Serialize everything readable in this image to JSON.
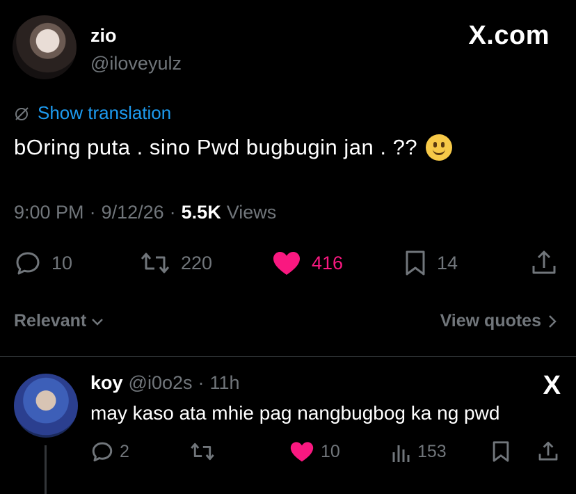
{
  "post": {
    "display_name": "zio",
    "handle": "@iloveyulz",
    "brand": "X.com",
    "show_translation": "Show translation",
    "text": "bOring  puta  .  sino Pwd  bugbugin  jan . ??",
    "emoji": "slightly-smiling-face",
    "time": "9:00 PM",
    "date": "9/12/26",
    "views_count": "5.5K",
    "views_label": "Views",
    "stats": {
      "replies": "10",
      "reposts": "220",
      "likes": "416",
      "bookmarks": "14"
    }
  },
  "sort": {
    "relevant_label": "Relevant",
    "view_quotes_label": "View quotes"
  },
  "reply": {
    "display_name": "koy",
    "handle": "@i0o2s",
    "age": "11h",
    "brand_glyph": "X",
    "text": "may kaso ata mhie pag nangbugbog ka ng pwd",
    "stats": {
      "replies": "2",
      "likes": "10",
      "views": "153"
    }
  },
  "colors": {
    "background": "#000000",
    "text_primary": "#e7e9ea",
    "text_secondary": "#71767b",
    "link": "#1d9bf0",
    "like": "#f91880",
    "divider": "#2f3336"
  }
}
